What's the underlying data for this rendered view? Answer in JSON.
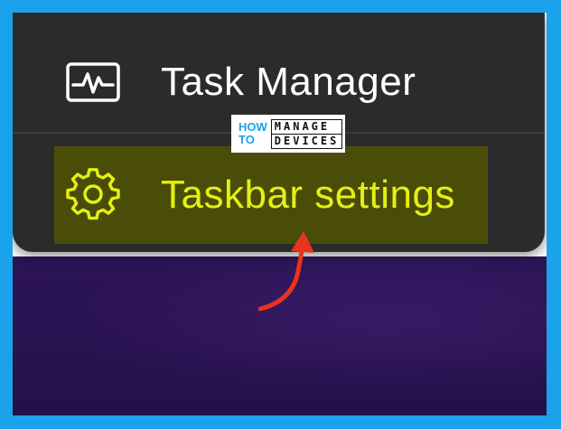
{
  "menu": {
    "items": [
      {
        "label": "Task Manager",
        "icon": "task-manager-icon"
      },
      {
        "label": "Taskbar settings",
        "icon": "gear-icon",
        "highlighted": true
      }
    ]
  },
  "watermark": {
    "how": "HOW",
    "to": "TO",
    "line1": "MANAGE",
    "line2": "DEVICES"
  },
  "colors": {
    "page_border": "#1aa3ea",
    "menu_background": "#2b2b2b",
    "highlight_background": "#4a4d08",
    "highlight_text": "#e6ef12",
    "arrow": "#e8331e",
    "wallpaper": "#2a1352"
  }
}
